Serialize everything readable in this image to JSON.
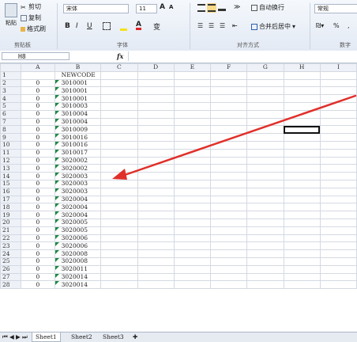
{
  "ribbon": {
    "paste": "粘贴",
    "cut": "剪切",
    "copy": "复制",
    "format_painter": "格式刷",
    "font_name": "宋体",
    "font_size": "11",
    "grow_font": "A",
    "shrink_font": "A",
    "bold": "B",
    "italic": "I",
    "underline": "U",
    "wrap_text": "自动换行",
    "merge_center": "合并后居中",
    "number_format": "常规",
    "percent": "%",
    "comma": ",",
    "group_clipboard": "剪贴板",
    "group_font": "字体",
    "group_alignment": "对齐方式",
    "group_number": "数字",
    "wen": "变"
  },
  "formula_bar": {
    "name_box": "H8",
    "fx": "fx",
    "value": ""
  },
  "columns": [
    "A",
    "B",
    "C",
    "D",
    "E",
    "F",
    "G",
    "H",
    "I"
  ],
  "rows": [
    {
      "n": "1",
      "a": "",
      "b": "NEWCODE"
    },
    {
      "n": "2",
      "a": "0",
      "b": "3010001"
    },
    {
      "n": "3",
      "a": "0",
      "b": "3010001"
    },
    {
      "n": "4",
      "a": "0",
      "b": "3010001"
    },
    {
      "n": "5",
      "a": "0",
      "b": "3010003"
    },
    {
      "n": "6",
      "a": "0",
      "b": "3010004"
    },
    {
      "n": "7",
      "a": "0",
      "b": "3010004"
    },
    {
      "n": "8",
      "a": "0",
      "b": "3010009"
    },
    {
      "n": "9",
      "a": "0",
      "b": "3010016"
    },
    {
      "n": "10",
      "a": "0",
      "b": "3010016"
    },
    {
      "n": "11",
      "a": "0",
      "b": "3010017"
    },
    {
      "n": "12",
      "a": "0",
      "b": "3020002"
    },
    {
      "n": "13",
      "a": "0",
      "b": "3020002"
    },
    {
      "n": "14",
      "a": "0",
      "b": "3020003"
    },
    {
      "n": "15",
      "a": "0",
      "b": "3020003"
    },
    {
      "n": "16",
      "a": "0",
      "b": "3020003"
    },
    {
      "n": "17",
      "a": "0",
      "b": "3020004"
    },
    {
      "n": "18",
      "a": "0",
      "b": "3020004"
    },
    {
      "n": "19",
      "a": "0",
      "b": "3020004"
    },
    {
      "n": "20",
      "a": "0",
      "b": "3020005"
    },
    {
      "n": "21",
      "a": "0",
      "b": "3020005"
    },
    {
      "n": "22",
      "a": "0",
      "b": "3020006"
    },
    {
      "n": "23",
      "a": "0",
      "b": "3020006"
    },
    {
      "n": "24",
      "a": "0",
      "b": "3020008"
    },
    {
      "n": "25",
      "a": "0",
      "b": "3020008"
    },
    {
      "n": "26",
      "a": "0",
      "b": "3020011"
    },
    {
      "n": "27",
      "a": "0",
      "b": "3020014"
    },
    {
      "n": "28",
      "a": "0",
      "b": "3020014"
    }
  ],
  "selected_cell": "H8",
  "sheets": [
    "Sheet1",
    "Sheet2",
    "Sheet3"
  ],
  "active_sheet": "Sheet1",
  "colors": {
    "arrow": "#e0302a",
    "selection_header": "#f9d98a",
    "text_marker": "#1c8a3e"
  }
}
